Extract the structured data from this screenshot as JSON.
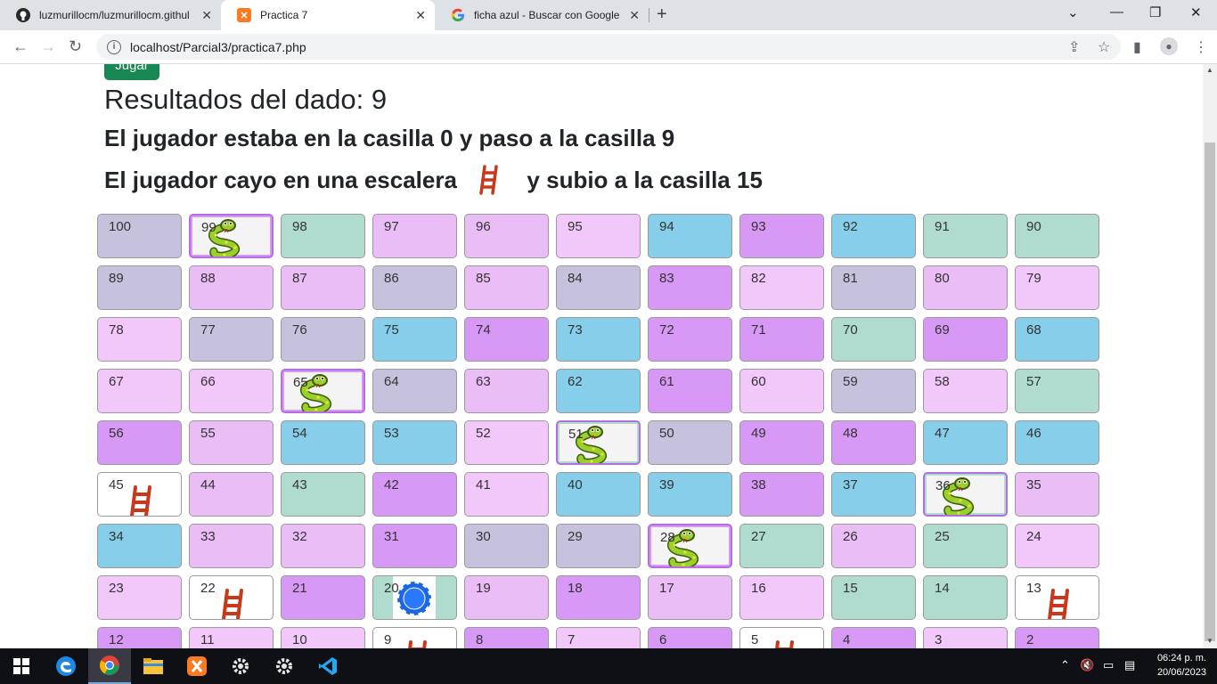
{
  "browser": {
    "tabs": [
      {
        "title": "luzmurillocm/luzmurillocm.githul",
        "icon": "github-icon"
      },
      {
        "title": "Practica 7",
        "icon": "xampp-icon"
      },
      {
        "title": "ficha azul - Buscar con Google",
        "icon": "google-icon"
      }
    ],
    "url": "localhost/Parcial3/practica7.php"
  },
  "page": {
    "play_button": "Jugar",
    "result_text": "Resultados del dado: 9",
    "line1": "El jugador estaba en la casilla 0 y paso a la casilla 9",
    "line2_pre": "El jugador cayo en una escalera",
    "line2_post": "y subio a la casilla 15"
  },
  "board": {
    "rows": [
      [
        {
          "n": "100",
          "c": "gray"
        },
        {
          "n": "99",
          "c": "purple",
          "icon": "snake"
        },
        {
          "n": "98",
          "c": "green"
        },
        {
          "n": "97",
          "c": "pink"
        },
        {
          "n": "96",
          "c": "pink"
        },
        {
          "n": "95",
          "c": "lpink"
        },
        {
          "n": "94",
          "c": "blue"
        },
        {
          "n": "93",
          "c": "purple"
        },
        {
          "n": "92",
          "c": "blue"
        },
        {
          "n": "91",
          "c": "green"
        },
        {
          "n": "90",
          "c": "green"
        }
      ],
      [
        {
          "n": "89",
          "c": "gray"
        },
        {
          "n": "88",
          "c": "pink"
        },
        {
          "n": "87",
          "c": "pink"
        },
        {
          "n": "86",
          "c": "gray"
        },
        {
          "n": "85",
          "c": "pink"
        },
        {
          "n": "84",
          "c": "gray"
        },
        {
          "n": "83",
          "c": "purple"
        },
        {
          "n": "82",
          "c": "lpink"
        },
        {
          "n": "81",
          "c": "gray"
        },
        {
          "n": "80",
          "c": "pink"
        },
        {
          "n": "79",
          "c": "lpink"
        }
      ],
      [
        {
          "n": "78",
          "c": "lpink"
        },
        {
          "n": "77",
          "c": "gray"
        },
        {
          "n": "76",
          "c": "gray"
        },
        {
          "n": "75",
          "c": "blue"
        },
        {
          "n": "74",
          "c": "purple"
        },
        {
          "n": "73",
          "c": "blue"
        },
        {
          "n": "72",
          "c": "purple"
        },
        {
          "n": "71",
          "c": "purple"
        },
        {
          "n": "70",
          "c": "green"
        },
        {
          "n": "69",
          "c": "purple"
        },
        {
          "n": "68",
          "c": "blue"
        }
      ],
      [
        {
          "n": "67",
          "c": "lpink"
        },
        {
          "n": "66",
          "c": "lpink"
        },
        {
          "n": "65",
          "c": "purple",
          "icon": "snake"
        },
        {
          "n": "64",
          "c": "gray"
        },
        {
          "n": "63",
          "c": "pink"
        },
        {
          "n": "62",
          "c": "blue"
        },
        {
          "n": "61",
          "c": "purple"
        },
        {
          "n": "60",
          "c": "lpink"
        },
        {
          "n": "59",
          "c": "gray"
        },
        {
          "n": "58",
          "c": "lpink"
        },
        {
          "n": "57",
          "c": "green"
        }
      ],
      [
        {
          "n": "56",
          "c": "purple"
        },
        {
          "n": "55",
          "c": "pink"
        },
        {
          "n": "54",
          "c": "blue"
        },
        {
          "n": "53",
          "c": "blue"
        },
        {
          "n": "52",
          "c": "lpink"
        },
        {
          "n": "51",
          "c": "green",
          "icon": "snake"
        },
        {
          "n": "50",
          "c": "gray"
        },
        {
          "n": "49",
          "c": "purple"
        },
        {
          "n": "48",
          "c": "purple"
        },
        {
          "n": "47",
          "c": "blue"
        },
        {
          "n": "46",
          "c": "blue"
        }
      ],
      [
        {
          "n": "45",
          "c": "white",
          "icon": "ladder"
        },
        {
          "n": "44",
          "c": "pink"
        },
        {
          "n": "43",
          "c": "green"
        },
        {
          "n": "42",
          "c": "purple"
        },
        {
          "n": "41",
          "c": "lpink"
        },
        {
          "n": "40",
          "c": "blue"
        },
        {
          "n": "39",
          "c": "blue"
        },
        {
          "n": "38",
          "c": "purple"
        },
        {
          "n": "37",
          "c": "blue"
        },
        {
          "n": "36",
          "c": "green",
          "icon": "snake"
        },
        {
          "n": "35",
          "c": "pink"
        }
      ],
      [
        {
          "n": "34",
          "c": "blue"
        },
        {
          "n": "33",
          "c": "pink"
        },
        {
          "n": "32",
          "c": "pink"
        },
        {
          "n": "31",
          "c": "purple"
        },
        {
          "n": "30",
          "c": "gray"
        },
        {
          "n": "29",
          "c": "gray"
        },
        {
          "n": "28",
          "c": "purple",
          "icon": "snake"
        },
        {
          "n": "27",
          "c": "green"
        },
        {
          "n": "26",
          "c": "pink"
        },
        {
          "n": "25",
          "c": "green"
        },
        {
          "n": "24",
          "c": "lpink"
        }
      ],
      [
        {
          "n": "23",
          "c": "lpink"
        },
        {
          "n": "22",
          "c": "white",
          "icon": "ladder"
        },
        {
          "n": "21",
          "c": "purple"
        },
        {
          "n": "20",
          "c": "green",
          "icon": "chip"
        },
        {
          "n": "19",
          "c": "pink"
        },
        {
          "n": "18",
          "c": "purple"
        },
        {
          "n": "17",
          "c": "pink"
        },
        {
          "n": "16",
          "c": "lpink"
        },
        {
          "n": "15",
          "c": "green"
        },
        {
          "n": "14",
          "c": "green"
        },
        {
          "n": "13",
          "c": "white",
          "icon": "ladder"
        }
      ],
      [
        {
          "n": "12",
          "c": "purple"
        },
        {
          "n": "11",
          "c": "lpink"
        },
        {
          "n": "10",
          "c": "lpink"
        },
        {
          "n": "9",
          "c": "white",
          "icon": "ladder"
        },
        {
          "n": "8",
          "c": "purple"
        },
        {
          "n": "7",
          "c": "lpink"
        },
        {
          "n": "6",
          "c": "purple"
        },
        {
          "n": "5",
          "c": "white",
          "icon": "ladder"
        },
        {
          "n": "4",
          "c": "purple"
        },
        {
          "n": "3",
          "c": "lpink"
        },
        {
          "n": "2",
          "c": "purple"
        }
      ]
    ]
  },
  "taskbar": {
    "time": "06:24 p. m.",
    "date": "20/06/2023"
  }
}
